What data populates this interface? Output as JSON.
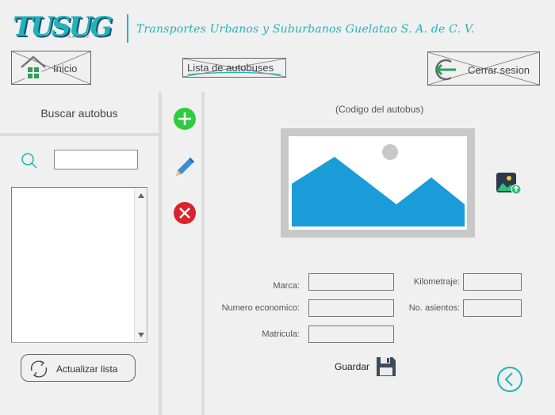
{
  "header": {
    "logo_text": "TUSUG",
    "logo_sub": "S.A. de C.V.",
    "company": "Transportes Urbanos y Suburbanos Guelatao S. A. de C. V."
  },
  "nav": {
    "home_label": "Inicio",
    "list_label": "Lista de autobuses",
    "logout_label": "Cerrar sesion"
  },
  "search": {
    "title": "Buscar autobus",
    "value": "",
    "refresh_label": "Actualizar lista"
  },
  "tools": {
    "add_icon": "add-icon",
    "edit_icon": "pencil-icon",
    "delete_icon": "delete-icon"
  },
  "form": {
    "bus_code": "(Codigo del autobus)",
    "marca_label": "Marca:",
    "numero_label": "Numero economico:",
    "matricula_label": "Matricula:",
    "km_label": "Kilometraje:",
    "asientos_label": "No. asientos:",
    "marca_value": "",
    "numero_value": "",
    "matricula_value": "",
    "km_value": "",
    "asientos_value": "",
    "save_label": "Guardar"
  },
  "colors": {
    "accent": "#1fb5b8",
    "add": "#2ecc40",
    "edit": "#3a8fd8",
    "delete": "#d9232d",
    "image_blue": "#1a9cd8"
  }
}
